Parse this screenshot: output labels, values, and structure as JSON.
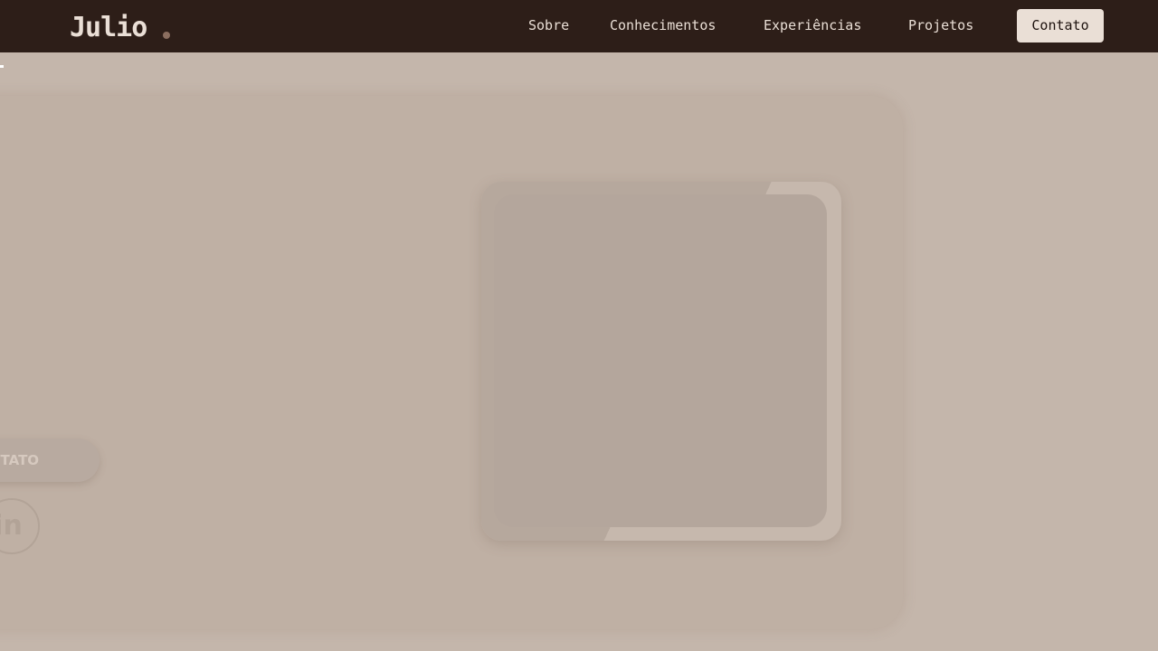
{
  "brand": {
    "logo_text": "Julio"
  },
  "nav": {
    "items": [
      {
        "label": "Sobre"
      },
      {
        "label": "Conhecimentos"
      },
      {
        "label": "Experiências"
      },
      {
        "label": "Projetos"
      }
    ],
    "contact_label": "Contato"
  },
  "hero": {
    "contact_button_label": "NTATO",
    "social": {
      "icon": "linkedin-icon",
      "label": "in"
    }
  },
  "colors": {
    "nav_background": "#2d1e18",
    "page_background": "#c4b6ab",
    "accent_text": "#eadfd6"
  }
}
